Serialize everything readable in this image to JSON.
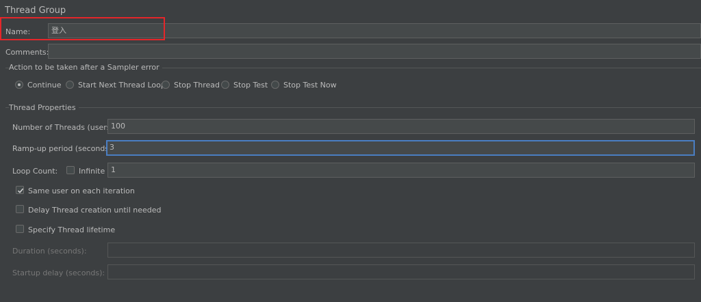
{
  "title": "Thread Group",
  "name": {
    "label": "Name:",
    "value": "登入"
  },
  "comments": {
    "label": "Comments:",
    "value": ""
  },
  "sampler_error": {
    "group_label": "Action to be taken after a Sampler error",
    "options": [
      "Continue",
      "Start Next Thread Loop",
      "Stop Thread",
      "Stop Test",
      "Stop Test Now"
    ],
    "selected": "Continue"
  },
  "thread_properties": {
    "group_label": "Thread Properties",
    "num_threads": {
      "label": "Number of Threads (users):",
      "value": "100"
    },
    "ramp_up": {
      "label": "Ramp-up period (seconds):",
      "value": "3"
    },
    "loop_count": {
      "label": "Loop Count:",
      "infinite_label": "Infinite",
      "infinite_checked": false,
      "value": "1"
    },
    "same_user": {
      "label": "Same user on each iteration",
      "checked": true
    },
    "delay_creation": {
      "label": "Delay Thread creation until needed",
      "checked": false
    },
    "specify_lifetime": {
      "label": "Specify Thread lifetime",
      "checked": false
    },
    "duration": {
      "label": "Duration (seconds):",
      "value": ""
    },
    "startup_delay": {
      "label": "Startup delay (seconds):",
      "value": ""
    }
  },
  "colors": {
    "background": "#3c3f41",
    "field": "#45494a",
    "focus": "#4a7ec2",
    "highlight": "#e5262a"
  }
}
